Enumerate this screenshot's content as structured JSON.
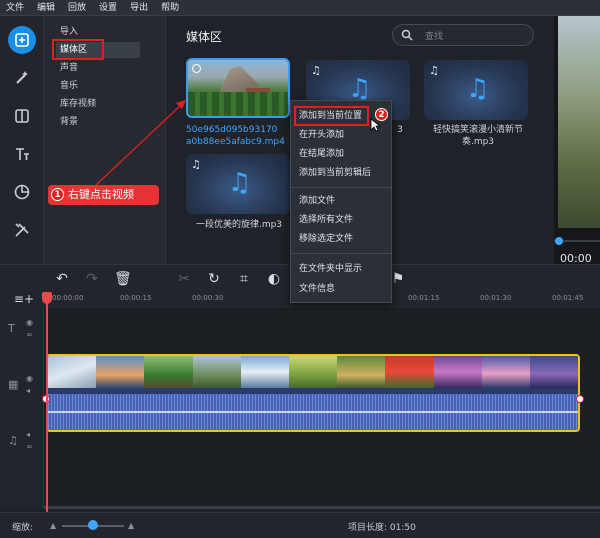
{
  "menubar": {
    "items": [
      "文件",
      "编辑",
      "回放",
      "设置",
      "导出",
      "帮助"
    ]
  },
  "sidebar": {
    "categories": [
      "导入",
      "媒体区",
      "声音",
      "音乐",
      "库存视频",
      "背景"
    ],
    "selected_index": 1
  },
  "media": {
    "title": "媒体区",
    "search_placeholder": "查找",
    "items": [
      {
        "type": "video",
        "caption_line1": "50e965d095b93170",
        "caption_line2": "a0b88ee5afabc9.mp4"
      },
      {
        "type": "audio",
        "caption": "3"
      },
      {
        "type": "audio",
        "caption": "轻快搞笑滚漫小清新节奏.mp3"
      },
      {
        "type": "audio",
        "caption": "一段优美的旋律.mp3"
      }
    ]
  },
  "context_menu": {
    "items": [
      "添加到当前位置",
      "在开头添加",
      "在结尾添加",
      "添加到当前剪辑后",
      "添加文件",
      "选择所有文件",
      "移除选定文件",
      "在文件夹中显示",
      "文件信息"
    ]
  },
  "annotations": {
    "step1_number": "1",
    "step1_text": "右键点击视频",
    "step2_number": "2"
  },
  "preview": {
    "timecode": "00:00"
  },
  "ruler": {
    "ticks": [
      "00:00:00",
      "00:00:15",
      "00:00:30",
      "00:01:15",
      "00:01:30",
      "00:01:45"
    ]
  },
  "status": {
    "zoom_label": "缩放:",
    "project_length": "项目长度: 01:50"
  },
  "colors": {
    "accent": "#1a8fe6",
    "annotation": "#e02020",
    "clip_border": "#f1c21b",
    "playhead": "#e74a4a"
  }
}
